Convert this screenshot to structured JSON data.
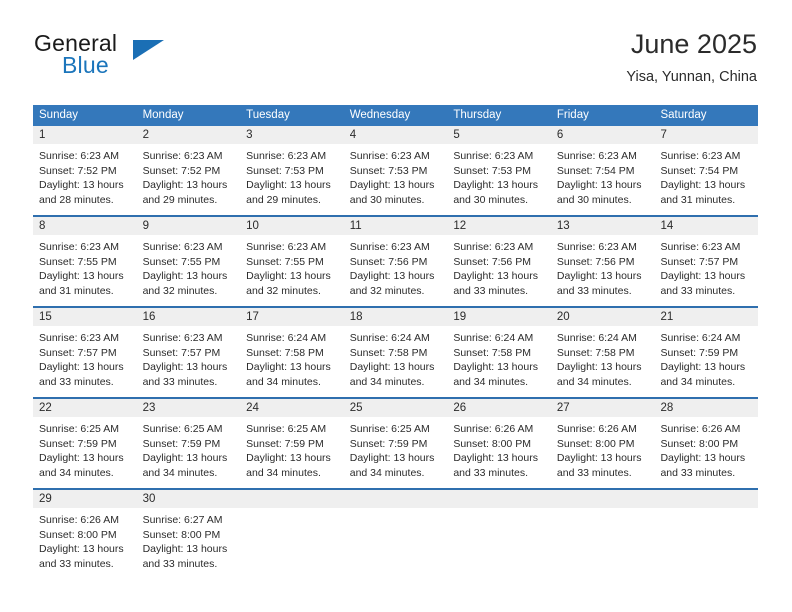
{
  "brand": {
    "name_top": "General",
    "name_bottom": "Blue",
    "triangle_color": "#1b6fb5",
    "blue_color": "#1b75bb"
  },
  "header": {
    "month_title": "June 2025",
    "location": "Yisa, Yunnan, China"
  },
  "theme": {
    "header_blue": "#3478bb",
    "row_divider_blue": "#2f6fae",
    "date_band_gray": "#efefef",
    "text_color": "#2b2b2b"
  },
  "calendar": {
    "day_headers": [
      "Sunday",
      "Monday",
      "Tuesday",
      "Wednesday",
      "Thursday",
      "Friday",
      "Saturday"
    ],
    "weeks": [
      [
        {
          "day": "1",
          "lines": [
            "Sunrise: 6:23 AM",
            "Sunset: 7:52 PM",
            "Daylight: 13 hours",
            "and 28 minutes."
          ]
        },
        {
          "day": "2",
          "lines": [
            "Sunrise: 6:23 AM",
            "Sunset: 7:52 PM",
            "Daylight: 13 hours",
            "and 29 minutes."
          ]
        },
        {
          "day": "3",
          "lines": [
            "Sunrise: 6:23 AM",
            "Sunset: 7:53 PM",
            "Daylight: 13 hours",
            "and 29 minutes."
          ]
        },
        {
          "day": "4",
          "lines": [
            "Sunrise: 6:23 AM",
            "Sunset: 7:53 PM",
            "Daylight: 13 hours",
            "and 30 minutes."
          ]
        },
        {
          "day": "5",
          "lines": [
            "Sunrise: 6:23 AM",
            "Sunset: 7:53 PM",
            "Daylight: 13 hours",
            "and 30 minutes."
          ]
        },
        {
          "day": "6",
          "lines": [
            "Sunrise: 6:23 AM",
            "Sunset: 7:54 PM",
            "Daylight: 13 hours",
            "and 30 minutes."
          ]
        },
        {
          "day": "7",
          "lines": [
            "Sunrise: 6:23 AM",
            "Sunset: 7:54 PM",
            "Daylight: 13 hours",
            "and 31 minutes."
          ]
        }
      ],
      [
        {
          "day": "8",
          "lines": [
            "Sunrise: 6:23 AM",
            "Sunset: 7:55 PM",
            "Daylight: 13 hours",
            "and 31 minutes."
          ]
        },
        {
          "day": "9",
          "lines": [
            "Sunrise: 6:23 AM",
            "Sunset: 7:55 PM",
            "Daylight: 13 hours",
            "and 32 minutes."
          ]
        },
        {
          "day": "10",
          "lines": [
            "Sunrise: 6:23 AM",
            "Sunset: 7:55 PM",
            "Daylight: 13 hours",
            "and 32 minutes."
          ]
        },
        {
          "day": "11",
          "lines": [
            "Sunrise: 6:23 AM",
            "Sunset: 7:56 PM",
            "Daylight: 13 hours",
            "and 32 minutes."
          ]
        },
        {
          "day": "12",
          "lines": [
            "Sunrise: 6:23 AM",
            "Sunset: 7:56 PM",
            "Daylight: 13 hours",
            "and 33 minutes."
          ]
        },
        {
          "day": "13",
          "lines": [
            "Sunrise: 6:23 AM",
            "Sunset: 7:56 PM",
            "Daylight: 13 hours",
            "and 33 minutes."
          ]
        },
        {
          "day": "14",
          "lines": [
            "Sunrise: 6:23 AM",
            "Sunset: 7:57 PM",
            "Daylight: 13 hours",
            "and 33 minutes."
          ]
        }
      ],
      [
        {
          "day": "15",
          "lines": [
            "Sunrise: 6:23 AM",
            "Sunset: 7:57 PM",
            "Daylight: 13 hours",
            "and 33 minutes."
          ]
        },
        {
          "day": "16",
          "lines": [
            "Sunrise: 6:23 AM",
            "Sunset: 7:57 PM",
            "Daylight: 13 hours",
            "and 33 minutes."
          ]
        },
        {
          "day": "17",
          "lines": [
            "Sunrise: 6:24 AM",
            "Sunset: 7:58 PM",
            "Daylight: 13 hours",
            "and 34 minutes."
          ]
        },
        {
          "day": "18",
          "lines": [
            "Sunrise: 6:24 AM",
            "Sunset: 7:58 PM",
            "Daylight: 13 hours",
            "and 34 minutes."
          ]
        },
        {
          "day": "19",
          "lines": [
            "Sunrise: 6:24 AM",
            "Sunset: 7:58 PM",
            "Daylight: 13 hours",
            "and 34 minutes."
          ]
        },
        {
          "day": "20",
          "lines": [
            "Sunrise: 6:24 AM",
            "Sunset: 7:58 PM",
            "Daylight: 13 hours",
            "and 34 minutes."
          ]
        },
        {
          "day": "21",
          "lines": [
            "Sunrise: 6:24 AM",
            "Sunset: 7:59 PM",
            "Daylight: 13 hours",
            "and 34 minutes."
          ]
        }
      ],
      [
        {
          "day": "22",
          "lines": [
            "Sunrise: 6:25 AM",
            "Sunset: 7:59 PM",
            "Daylight: 13 hours",
            "and 34 minutes."
          ]
        },
        {
          "day": "23",
          "lines": [
            "Sunrise: 6:25 AM",
            "Sunset: 7:59 PM",
            "Daylight: 13 hours",
            "and 34 minutes."
          ]
        },
        {
          "day": "24",
          "lines": [
            "Sunrise: 6:25 AM",
            "Sunset: 7:59 PM",
            "Daylight: 13 hours",
            "and 34 minutes."
          ]
        },
        {
          "day": "25",
          "lines": [
            "Sunrise: 6:25 AM",
            "Sunset: 7:59 PM",
            "Daylight: 13 hours",
            "and 34 minutes."
          ]
        },
        {
          "day": "26",
          "lines": [
            "Sunrise: 6:26 AM",
            "Sunset: 8:00 PM",
            "Daylight: 13 hours",
            "and 33 minutes."
          ]
        },
        {
          "day": "27",
          "lines": [
            "Sunrise: 6:26 AM",
            "Sunset: 8:00 PM",
            "Daylight: 13 hours",
            "and 33 minutes."
          ]
        },
        {
          "day": "28",
          "lines": [
            "Sunrise: 6:26 AM",
            "Sunset: 8:00 PM",
            "Daylight: 13 hours",
            "and 33 minutes."
          ]
        }
      ],
      [
        {
          "day": "29",
          "lines": [
            "Sunrise: 6:26 AM",
            "Sunset: 8:00 PM",
            "Daylight: 13 hours",
            "and 33 minutes."
          ]
        },
        {
          "day": "30",
          "lines": [
            "Sunrise: 6:27 AM",
            "Sunset: 8:00 PM",
            "Daylight: 13 hours",
            "and 33 minutes."
          ]
        },
        {
          "day": "",
          "lines": []
        },
        {
          "day": "",
          "lines": []
        },
        {
          "day": "",
          "lines": []
        },
        {
          "day": "",
          "lines": []
        },
        {
          "day": "",
          "lines": []
        }
      ]
    ]
  }
}
